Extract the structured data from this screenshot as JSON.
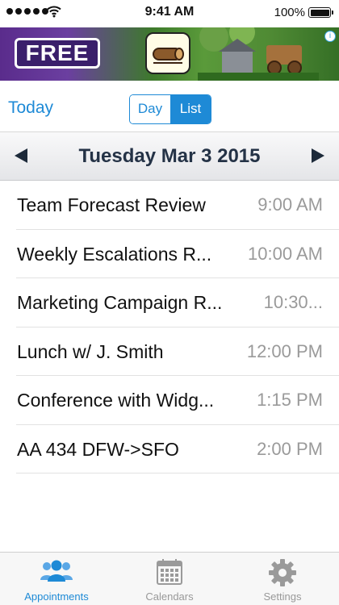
{
  "status_bar": {
    "time": "9:41 AM",
    "battery": "100%"
  },
  "ad": {
    "badge_text": "FREE",
    "close_label": "i",
    "colors": {
      "badge_bg": "#3a1f6b",
      "left_bg": "#5a2c8c",
      "right_bg": "#3d7a2b"
    }
  },
  "toolbar": {
    "today_label": "Today",
    "view_options": [
      "Day",
      "List"
    ],
    "selected_view": "List"
  },
  "date_nav": {
    "date_label": "Tuesday Mar 3 2015",
    "prev_icon": "triangle-left-icon",
    "next_icon": "triangle-right-icon"
  },
  "appointments": [
    {
      "title": "Team Forecast Review",
      "time": "9:00 AM"
    },
    {
      "title": "Weekly Escalations R...",
      "time": "10:00 AM"
    },
    {
      "title": "Marketing Campaign R...",
      "time": "10:30..."
    },
    {
      "title": "Lunch w/ J. Smith",
      "time": "12:00 PM"
    },
    {
      "title": "Conference with Widg...",
      "time": "1:15 PM"
    },
    {
      "title": "AA 434 DFW->SFO",
      "time": "2:00 PM"
    }
  ],
  "tabs": [
    {
      "label": "Appointments",
      "icon": "people-icon",
      "active": true
    },
    {
      "label": "Calendars",
      "icon": "calendar-grid-icon",
      "active": false
    },
    {
      "label": "Settings",
      "icon": "gear-icon",
      "active": false
    }
  ],
  "colors": {
    "accent": "#1e8ad6",
    "date_text": "#243246",
    "time_text": "#9a9a9a",
    "inactive_tab": "#999999"
  }
}
